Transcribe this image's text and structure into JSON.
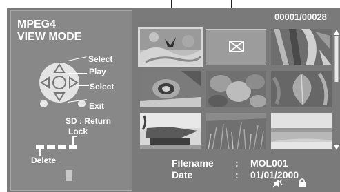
{
  "mode": {
    "line1": "MPEG4",
    "line2": "VIEW MODE"
  },
  "counter": "00001/00028",
  "legend": {
    "select_top": "Select",
    "play": "Play",
    "select_right": "Select",
    "exit": "Exit",
    "sd_return": "SD : Return",
    "lock": "Lock",
    "delete": "Delete"
  },
  "info": {
    "filename_label": "Filename",
    "filename_sep": ":",
    "filename_value": "MOL001",
    "date_label": "Date",
    "date_sep": ":",
    "date_value": "01/01/2000"
  },
  "thumbnails": [
    {
      "name": "thumb-butterfly",
      "kind": "photo",
      "selected": true
    },
    {
      "name": "thumb-error",
      "kind": "error-icon",
      "selected": false
    },
    {
      "name": "thumb-leaves-fabric",
      "kind": "photo",
      "selected": false
    },
    {
      "name": "thumb-flower-closeup",
      "kind": "photo",
      "selected": false
    },
    {
      "name": "thumb-leaves-garden",
      "kind": "photo",
      "selected": false
    },
    {
      "name": "thumb-plant-leaf",
      "kind": "photo",
      "selected": false
    },
    {
      "name": "thumb-thatched-hut",
      "kind": "photo",
      "selected": false
    },
    {
      "name": "thumb-grass-field",
      "kind": "photo",
      "selected": false
    },
    {
      "name": "thumb-beach",
      "kind": "photo",
      "selected": false
    }
  ],
  "colors": {
    "screen_bg": "#7a7a7a",
    "panel_bg": "#888888",
    "text": "#ffffff",
    "highlight": "#d9d9d9"
  }
}
